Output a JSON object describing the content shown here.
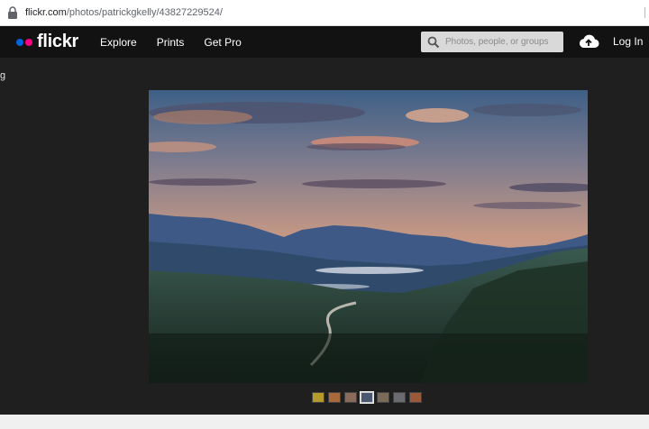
{
  "browser": {
    "url_host": "flickr.com",
    "url_path": "/photos/patrickgkelly/43827229524/"
  },
  "nav": {
    "logo_text": "flickr",
    "links": [
      "Explore",
      "Prints",
      "Get Pro"
    ],
    "search_placeholder": "Photos, people, or groups",
    "login_label": "Log In",
    "colors": {
      "blue_dot": "#0063dc",
      "pink_dot": "#ff0084",
      "bar": "#121212"
    }
  },
  "photo_page": {
    "back_label": "g",
    "photo_icon": "landscape-photo",
    "thumbnails": [
      {
        "icon": "thumb-yellow",
        "color": "#b39a2a",
        "active": false
      },
      {
        "icon": "thumb-sunset",
        "color": "#a86a3a",
        "active": false
      },
      {
        "icon": "thumb-dusk",
        "color": "#8a6a5a",
        "active": false
      },
      {
        "icon": "thumb-current",
        "color": "#4a5870",
        "active": true
      },
      {
        "icon": "thumb-mountain",
        "color": "#7a6a5a",
        "active": false
      },
      {
        "icon": "thumb-grey",
        "color": "#6a6a72",
        "active": false
      },
      {
        "icon": "thumb-red",
        "color": "#9a5a3a",
        "active": false
      }
    ]
  }
}
